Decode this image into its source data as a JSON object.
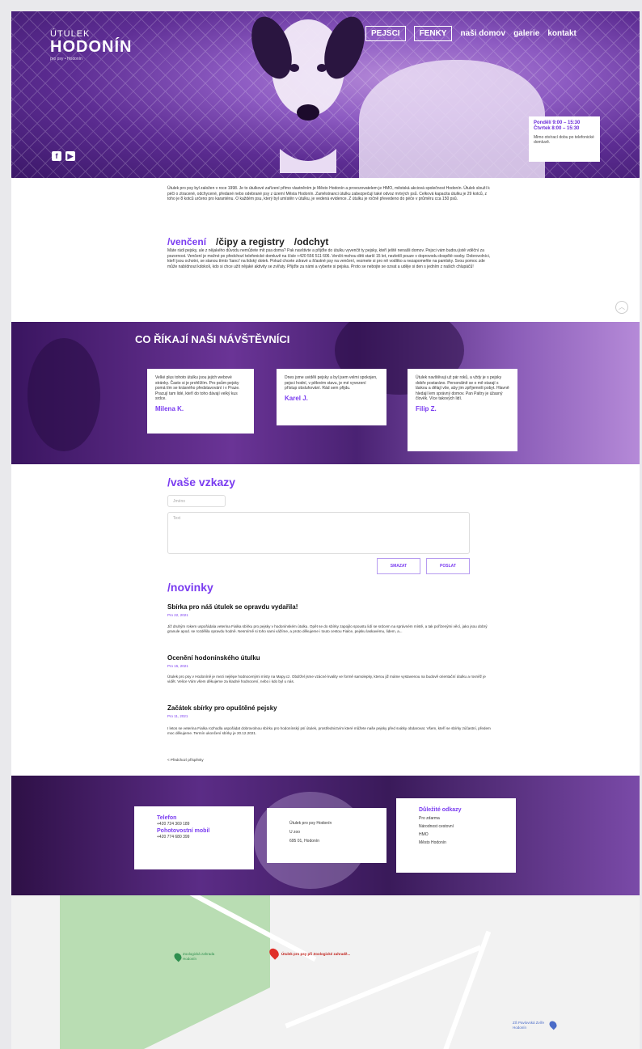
{
  "header": {
    "logo_top": "ÚTULEK",
    "logo_main": "HODONÍN",
    "logo_sub": "pro psy • Hodonín",
    "nav": [
      "PEJSCI",
      "FENKY",
      "naši domov",
      "galerie",
      "kontakt"
    ],
    "social": [
      {
        "icon": "facebook-icon",
        "glyph": "f"
      },
      {
        "icon": "youtube-icon",
        "glyph": "▶"
      }
    ],
    "hours": {
      "line1": "Pondělí 9:00 – 15:30",
      "line2": "Čtvrtek 8:00 – 15:30",
      "note": "Mimo otvírací dobu po telefonické domluvě."
    }
  },
  "intro": {
    "text": "Útulek pro psy byl založen v roce 1998. Je to útulkové zařízení přímo vlastněním je Město Hodonín a provozovatelem je HMO, městská akciová společnost Hodonín. Útulek slouží k péči o ztracené, odchycené, předané nebo odebrané psy z území Města Hodonín. Zaměstnanci útulku zabezpečují také odvoz mrtvých psů. Celková kapacita útulku je 29 kotců, z toho je 8 kotců určeno pro karanténu. O každém psu, který byl umístěn v útulku, je vedená evidence. Z útulku je ročně převedeno do péče v průměru cca 150 psů."
  },
  "tabs": {
    "items": [
      "/venčení",
      "/čipy a registry",
      "/odchyt"
    ],
    "content": "Máte rádi pejsky, ale z nějakého důvodu nemůžete mít psa doma? Pak navštivte a přijďte do útulku vyvenčit ty pejsky, kteří ještě nenašli domov. Pejsci vám budou jistě vděční za pozornost. Venčení je možné po předchozí telefonické domluvě na čísle +420 556 511 606. Venčit mohou děti starší 15 let, nezletilí pouze v doprovodu dospělé osoby. Dobrovolníci, kteří jsou ochotni, se stanou tímto 'šanci' na lidský dotek. Pokud chcete zdravé a šťastné psy na venčení, vezmete si pro ně vodítko a nezapomeňte na pamlsky. Svou pomoc zde může nabídnout kdokoli, kdo si chce užít nějaké aktivity se zvířaty. Přijďte za námi a vyberte si pejska. Proto se nebojte se ozvat a uděje si den s jedním z našich chlupáčů!"
  },
  "testimonials": {
    "title": "CO ŘÍKAJÍ NAŠI NÁVŠTĚVNÍCI",
    "items": [
      {
        "text": "Velké plus tohoto útulku jsou jejich webové stránky. Často si je prohlížím. Pro psům pejsky pomá tím se krásného představování i v Praze. Pracují tam lidé, kteří do toho dávají velký kus srdce.",
        "name": "Milena K."
      },
      {
        "text": "Dnes jsme uviděli pejsky a byl jsem velmi spokojen, pejsci hodní, v pěkném stavu, je mé vyvezení přístup obsluhování. Rád sem přijdu.",
        "name": "Karel J."
      },
      {
        "text": "Útulek navštěvuji už pár roků, a vždy je s pejsky dobře postaráno. Personálně se o mě starají s láskou a dělají vše, aby jim zpříjemnili pobyt. Hlavně hledají lem správný domov. Pan Paltry je úžasný člověk. Více takových lidí.",
        "name": "Filip Z."
      }
    ]
  },
  "messages": {
    "title": "/vaše vzkazy",
    "name_placeholder": "Jméno",
    "text_placeholder": "Text",
    "clear_label": "SMAZAT",
    "send_label": "POSLAT"
  },
  "news": {
    "title": "/novinky",
    "items": [
      {
        "title": "Sbírka pro náš útulek se opravdu vydařila!",
        "date": "Pro 22, 2021",
        "text": "Již druhým rokem uspořádala veterina Fialka sbírku pro pejsky v hodonínském útulku. Opět se do sbírky zapojilo spoustu lidí se srdcem na správném místě, a tak pořízenými věcí, jako jsou dobrý granule apod. se rozdělila opravdu hodně. Nesmírně si toho sami vážíme, a proto děkujeme i touto cestou Fialce, pejsku laskavému, lidem, a..."
      },
      {
        "title": "Ocenění hodonínského útulku",
        "date": "Pro 15, 2021",
        "text": "Útulek pro psy v Hodoníně je mezi nejlépe hodnocenými místy na Mapy.cz. Obdržel jsme vzácné kvality ve formě samolepky, kterou již máme vystavenou na budově orientační útulku a rovněž je vidět. Velice Vám všem děkujeme za kladné hodnocení, nebo i kdo byl u nás."
      },
      {
        "title": "Začátek sbírky pro opuštěné pejsky",
        "date": "Pro 11, 2021",
        "text": "I letos se veterina Fialka rozhodla uspořádat dobrovolnou sbírku pro hodonínský psí útulek, prostřednictvím které můžete naše pejsky před svátky obdarovat. Všem, kteří se sbírky zúčastní, předem moc děkujeme. Termín ukončení sbírky je 20.12.2021."
      }
    ],
    "more": "< Předchozí příspěvky"
  },
  "contact": {
    "phone_label": "Telefon",
    "phone": "+420 724 369 189",
    "emergency_label": "Pohotovostní mobil",
    "emergency": "+420 774 680 399",
    "address": [
      "Útulek pro psy Hodonín",
      "U zoo",
      "695 01, Hodonín"
    ],
    "links_title": "Důležité odkazy",
    "links": [
      "Pro zdarma",
      "Národnost cestovní",
      "HMO",
      "Město Hodonín"
    ]
  },
  "map": {
    "pin_red_label": "Útulek pro psy při Zoologické zahradě...",
    "pin_green_label": "Zoologická zahrada Hodonín",
    "pin_blue_label": "ZŠ Pavlovská Zvíře Hodonín"
  }
}
